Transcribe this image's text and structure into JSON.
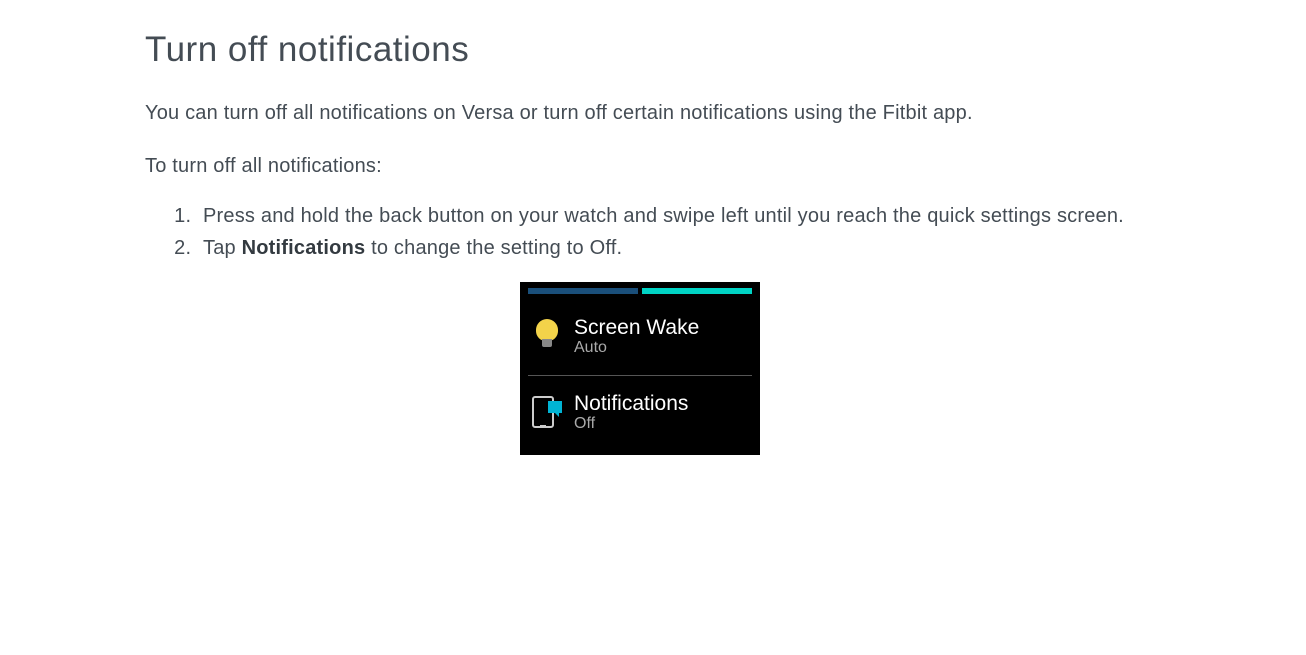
{
  "heading": "Turn off notifications",
  "intro": "You can turn off all notifications on Versa or turn off certain notifications using the Fitbit app.",
  "subtitle": "To turn off all notifications:",
  "steps": {
    "s1": "Press and hold the back button on your watch and swipe left until you reach the quick settings screen.",
    "s2_prefix": "Tap ",
    "s2_bold": "Notifications",
    "s2_suffix": " to change the setting to Off."
  },
  "device": {
    "row1_title": "Screen Wake",
    "row1_status": "Auto",
    "row2_title": "Notifications",
    "row2_status": "Off"
  }
}
